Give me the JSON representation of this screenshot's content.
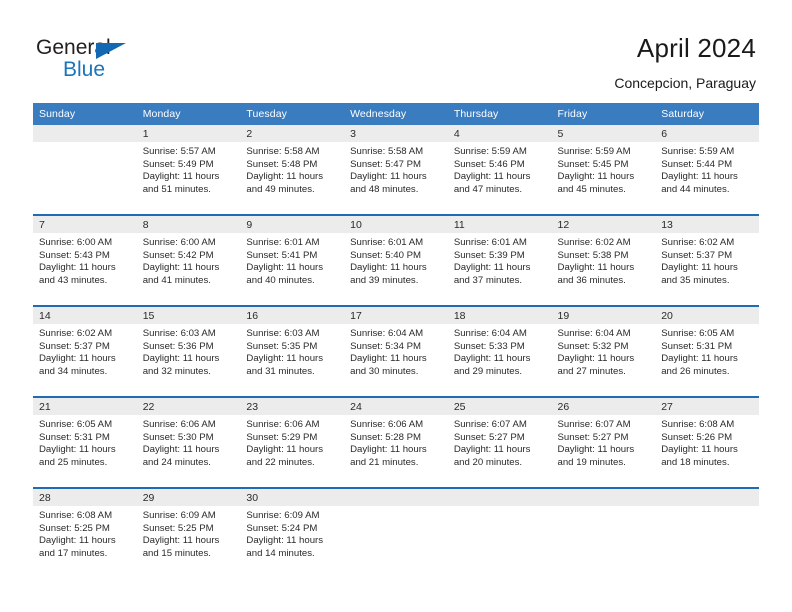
{
  "logo": {
    "word1": "General",
    "word2": "Blue",
    "flag_icon": "blue-triangle-flag",
    "color_dark": "#231f20",
    "color_blue": "#1b75bb"
  },
  "header": {
    "title": "April 2024",
    "subtitle": "Concepcion, Paraguay"
  },
  "theme": {
    "header_blue": "#3a7cc0",
    "row_divider_blue": "#1f6cb5",
    "daynum_band_gray": "#ececec",
    "text_color": "#2a2a2a"
  },
  "weekdays": [
    "Sunday",
    "Monday",
    "Tuesday",
    "Wednesday",
    "Thursday",
    "Friday",
    "Saturday"
  ],
  "weeks": [
    [
      {
        "day": "",
        "sunrise": "",
        "sunset": "",
        "daylight1": "",
        "daylight2": "",
        "empty": true
      },
      {
        "day": "1",
        "sunrise": "Sunrise: 5:57 AM",
        "sunset": "Sunset: 5:49 PM",
        "daylight1": "Daylight: 11 hours",
        "daylight2": "and 51 minutes."
      },
      {
        "day": "2",
        "sunrise": "Sunrise: 5:58 AM",
        "sunset": "Sunset: 5:48 PM",
        "daylight1": "Daylight: 11 hours",
        "daylight2": "and 49 minutes."
      },
      {
        "day": "3",
        "sunrise": "Sunrise: 5:58 AM",
        "sunset": "Sunset: 5:47 PM",
        "daylight1": "Daylight: 11 hours",
        "daylight2": "and 48 minutes."
      },
      {
        "day": "4",
        "sunrise": "Sunrise: 5:59 AM",
        "sunset": "Sunset: 5:46 PM",
        "daylight1": "Daylight: 11 hours",
        "daylight2": "and 47 minutes."
      },
      {
        "day": "5",
        "sunrise": "Sunrise: 5:59 AM",
        "sunset": "Sunset: 5:45 PM",
        "daylight1": "Daylight: 11 hours",
        "daylight2": "and 45 minutes."
      },
      {
        "day": "6",
        "sunrise": "Sunrise: 5:59 AM",
        "sunset": "Sunset: 5:44 PM",
        "daylight1": "Daylight: 11 hours",
        "daylight2": "and 44 minutes."
      }
    ],
    [
      {
        "day": "7",
        "sunrise": "Sunrise: 6:00 AM",
        "sunset": "Sunset: 5:43 PM",
        "daylight1": "Daylight: 11 hours",
        "daylight2": "and 43 minutes."
      },
      {
        "day": "8",
        "sunrise": "Sunrise: 6:00 AM",
        "sunset": "Sunset: 5:42 PM",
        "daylight1": "Daylight: 11 hours",
        "daylight2": "and 41 minutes."
      },
      {
        "day": "9",
        "sunrise": "Sunrise: 6:01 AM",
        "sunset": "Sunset: 5:41 PM",
        "daylight1": "Daylight: 11 hours",
        "daylight2": "and 40 minutes."
      },
      {
        "day": "10",
        "sunrise": "Sunrise: 6:01 AM",
        "sunset": "Sunset: 5:40 PM",
        "daylight1": "Daylight: 11 hours",
        "daylight2": "and 39 minutes."
      },
      {
        "day": "11",
        "sunrise": "Sunrise: 6:01 AM",
        "sunset": "Sunset: 5:39 PM",
        "daylight1": "Daylight: 11 hours",
        "daylight2": "and 37 minutes."
      },
      {
        "day": "12",
        "sunrise": "Sunrise: 6:02 AM",
        "sunset": "Sunset: 5:38 PM",
        "daylight1": "Daylight: 11 hours",
        "daylight2": "and 36 minutes."
      },
      {
        "day": "13",
        "sunrise": "Sunrise: 6:02 AM",
        "sunset": "Sunset: 5:37 PM",
        "daylight1": "Daylight: 11 hours",
        "daylight2": "and 35 minutes."
      }
    ],
    [
      {
        "day": "14",
        "sunrise": "Sunrise: 6:02 AM",
        "sunset": "Sunset: 5:37 PM",
        "daylight1": "Daylight: 11 hours",
        "daylight2": "and 34 minutes."
      },
      {
        "day": "15",
        "sunrise": "Sunrise: 6:03 AM",
        "sunset": "Sunset: 5:36 PM",
        "daylight1": "Daylight: 11 hours",
        "daylight2": "and 32 minutes."
      },
      {
        "day": "16",
        "sunrise": "Sunrise: 6:03 AM",
        "sunset": "Sunset: 5:35 PM",
        "daylight1": "Daylight: 11 hours",
        "daylight2": "and 31 minutes."
      },
      {
        "day": "17",
        "sunrise": "Sunrise: 6:04 AM",
        "sunset": "Sunset: 5:34 PM",
        "daylight1": "Daylight: 11 hours",
        "daylight2": "and 30 minutes."
      },
      {
        "day": "18",
        "sunrise": "Sunrise: 6:04 AM",
        "sunset": "Sunset: 5:33 PM",
        "daylight1": "Daylight: 11 hours",
        "daylight2": "and 29 minutes."
      },
      {
        "day": "19",
        "sunrise": "Sunrise: 6:04 AM",
        "sunset": "Sunset: 5:32 PM",
        "daylight1": "Daylight: 11 hours",
        "daylight2": "and 27 minutes."
      },
      {
        "day": "20",
        "sunrise": "Sunrise: 6:05 AM",
        "sunset": "Sunset: 5:31 PM",
        "daylight1": "Daylight: 11 hours",
        "daylight2": "and 26 minutes."
      }
    ],
    [
      {
        "day": "21",
        "sunrise": "Sunrise: 6:05 AM",
        "sunset": "Sunset: 5:31 PM",
        "daylight1": "Daylight: 11 hours",
        "daylight2": "and 25 minutes."
      },
      {
        "day": "22",
        "sunrise": "Sunrise: 6:06 AM",
        "sunset": "Sunset: 5:30 PM",
        "daylight1": "Daylight: 11 hours",
        "daylight2": "and 24 minutes."
      },
      {
        "day": "23",
        "sunrise": "Sunrise: 6:06 AM",
        "sunset": "Sunset: 5:29 PM",
        "daylight1": "Daylight: 11 hours",
        "daylight2": "and 22 minutes."
      },
      {
        "day": "24",
        "sunrise": "Sunrise: 6:06 AM",
        "sunset": "Sunset: 5:28 PM",
        "daylight1": "Daylight: 11 hours",
        "daylight2": "and 21 minutes."
      },
      {
        "day": "25",
        "sunrise": "Sunrise: 6:07 AM",
        "sunset": "Sunset: 5:27 PM",
        "daylight1": "Daylight: 11 hours",
        "daylight2": "and 20 minutes."
      },
      {
        "day": "26",
        "sunrise": "Sunrise: 6:07 AM",
        "sunset": "Sunset: 5:27 PM",
        "daylight1": "Daylight: 11 hours",
        "daylight2": "and 19 minutes."
      },
      {
        "day": "27",
        "sunrise": "Sunrise: 6:08 AM",
        "sunset": "Sunset: 5:26 PM",
        "daylight1": "Daylight: 11 hours",
        "daylight2": "and 18 minutes."
      }
    ],
    [
      {
        "day": "28",
        "sunrise": "Sunrise: 6:08 AM",
        "sunset": "Sunset: 5:25 PM",
        "daylight1": "Daylight: 11 hours",
        "daylight2": "and 17 minutes."
      },
      {
        "day": "29",
        "sunrise": "Sunrise: 6:09 AM",
        "sunset": "Sunset: 5:25 PM",
        "daylight1": "Daylight: 11 hours",
        "daylight2": "and 15 minutes."
      },
      {
        "day": "30",
        "sunrise": "Sunrise: 6:09 AM",
        "sunset": "Sunset: 5:24 PM",
        "daylight1": "Daylight: 11 hours",
        "daylight2": "and 14 minutes."
      },
      {
        "day": "",
        "sunrise": "",
        "sunset": "",
        "daylight1": "",
        "daylight2": "",
        "empty": true
      },
      {
        "day": "",
        "sunrise": "",
        "sunset": "",
        "daylight1": "",
        "daylight2": "",
        "empty": true
      },
      {
        "day": "",
        "sunrise": "",
        "sunset": "",
        "daylight1": "",
        "daylight2": "",
        "empty": true
      },
      {
        "day": "",
        "sunrise": "",
        "sunset": "",
        "daylight1": "",
        "daylight2": "",
        "empty": true
      }
    ]
  ]
}
